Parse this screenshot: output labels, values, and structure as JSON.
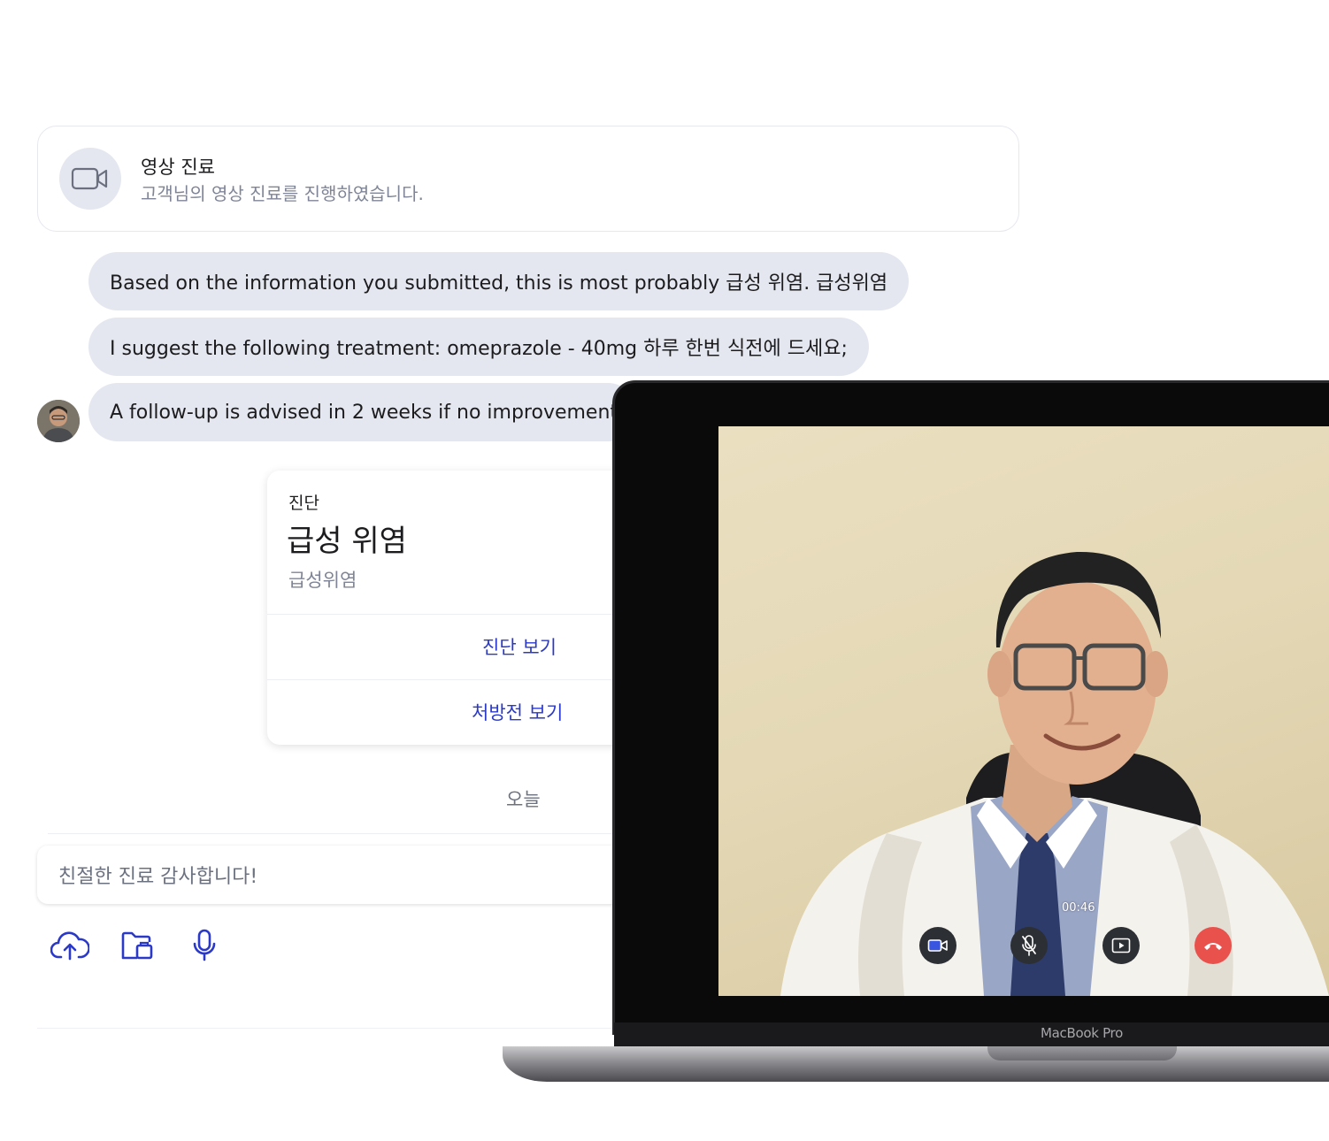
{
  "video_card": {
    "title": "영상 진료",
    "subtitle": "고객님의 영상 진료를 진행하였습니다.",
    "icon": "video-camera-icon"
  },
  "messages": [
    {
      "text": "Based on the information you submitted, this is most probably 급성 위염. 급성위염"
    },
    {
      "text": "I suggest the following treatment: omeprazole - 40mg 하루 한번 식전에 드세요;"
    },
    {
      "text": "A follow-up is advised in 2 weeks if no improvement"
    }
  ],
  "diagnosis_card": {
    "kicker": "진단",
    "name": "급성 위염",
    "sub": "급성위염",
    "view_diagnosis": "진단 보기",
    "view_prescription": "처방전 보기"
  },
  "date_separator": "오늘",
  "composer": {
    "message": "친절한 진료 감사합니다!",
    "tools": [
      "cloud-upload-icon",
      "folder-icon",
      "microphone-icon"
    ]
  },
  "video_call": {
    "timer": "00:46",
    "controls": [
      "camera-toggle-icon",
      "mute-mic-icon",
      "screen-share-icon",
      "hang-up-icon"
    ],
    "end_call_color": "#e9514d"
  },
  "device": {
    "label": "MacBook Pro"
  },
  "colors": {
    "accent": "#2b39c8",
    "bubble": "#e4e7ef"
  }
}
